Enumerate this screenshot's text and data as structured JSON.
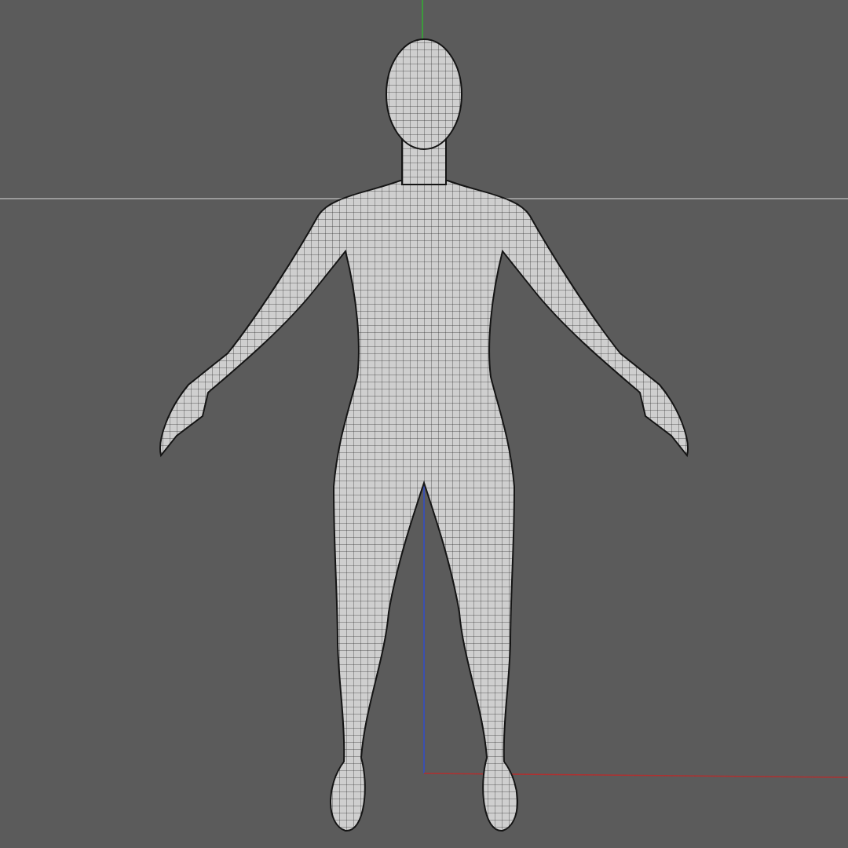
{
  "axes": [
    {
      "kind": "vertical-top",
      "color": "#3c9a3c"
    },
    {
      "kind": "horizontal-mid",
      "color": "#9a9a9a"
    },
    {
      "kind": "vertical-bottom",
      "color": "#3a4fb0"
    },
    {
      "kind": "horizontal-bottom",
      "color": "#b03030"
    }
  ]
}
